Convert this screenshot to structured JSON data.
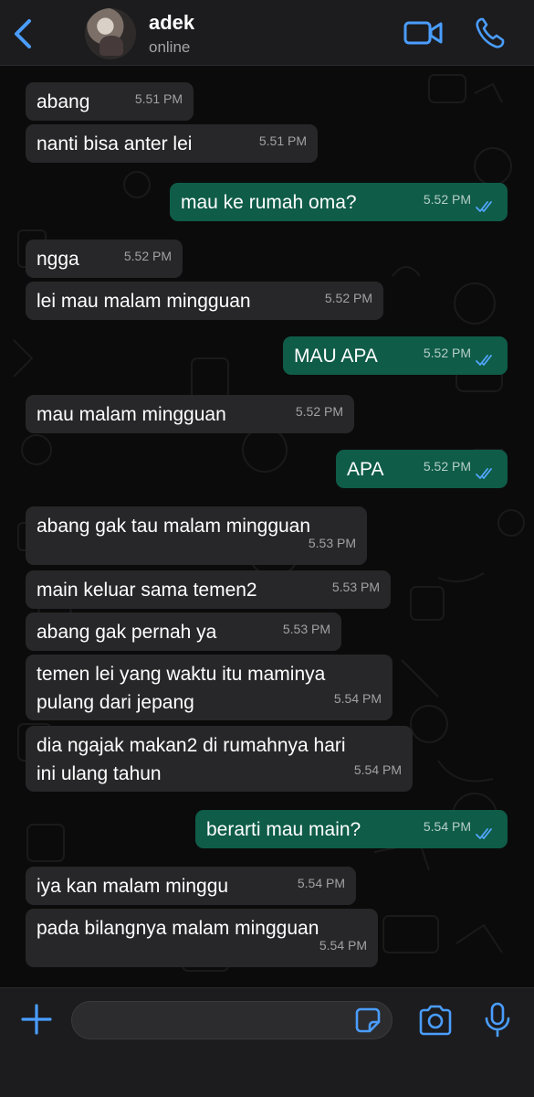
{
  "header": {
    "contact_name": "adek",
    "status": "online"
  },
  "icons": {
    "back": "chevron-left-icon",
    "video": "video-camera-icon",
    "call": "phone-icon",
    "add": "plus-icon",
    "sticker": "sticker-icon",
    "camera": "camera-icon",
    "mic": "microphone-icon",
    "read_receipt": "double-check-icon"
  },
  "colors": {
    "accent": "#4a9dff",
    "incoming_bubble": "#272729",
    "outgoing_bubble": "#0f5c48",
    "read_tick": "#53a6ff"
  },
  "messages": [
    {
      "dir": "in",
      "text": "abang",
      "time": "5.51 PM"
    },
    {
      "dir": "in",
      "text": "nanti bisa anter lei",
      "time": "5.51 PM"
    },
    {
      "dir": "out",
      "text": "mau ke rumah oma?",
      "time": "5.52 PM"
    },
    {
      "dir": "in",
      "text": "ngga",
      "time": "5.52 PM"
    },
    {
      "dir": "in",
      "text": "lei mau malam mingguan",
      "time": "5.52 PM"
    },
    {
      "dir": "out",
      "text": "MAU APA",
      "time": "5.52 PM"
    },
    {
      "dir": "in",
      "text": "mau malam mingguan",
      "time": "5.52 PM"
    },
    {
      "dir": "out",
      "text": "APA",
      "time": "5.52 PM"
    },
    {
      "dir": "in",
      "text": "abang gak tau malam mingguan",
      "time": "5.53 PM"
    },
    {
      "dir": "in",
      "text": "main keluar sama temen2",
      "time": "5.53 PM"
    },
    {
      "dir": "in",
      "text": "abang gak pernah ya",
      "time": "5.53 PM"
    },
    {
      "dir": "in",
      "text": "temen lei yang waktu itu maminya\npulang dari jepang",
      "time": "5.54 PM"
    },
    {
      "dir": "in",
      "text": "dia ngajak makan2 di rumahnya hari\nini ulang tahun",
      "time": "5.54 PM"
    },
    {
      "dir": "out",
      "text": "berarti mau main?",
      "time": "5.54 PM"
    },
    {
      "dir": "in",
      "text": "iya kan malam minggu",
      "time": "5.54 PM"
    },
    {
      "dir": "in",
      "text": "pada bilangnya malam mingguan",
      "time": "5.54 PM"
    }
  ]
}
